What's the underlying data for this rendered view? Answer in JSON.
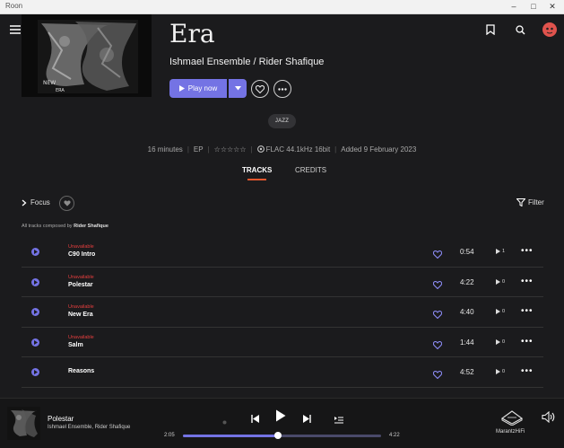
{
  "window": {
    "title": "Roon",
    "controls": [
      "minimize-icon",
      "maximize-icon",
      "close-icon"
    ]
  },
  "album": {
    "title": "Era",
    "artists": "Ishmael Ensemble / Rider Shafique",
    "cover_text": [
      "NEW",
      "ERA"
    ],
    "play_label": "Play now",
    "genre": "JAZZ",
    "meta": {
      "duration": "16 minutes",
      "type": "EP",
      "rating": "☆☆☆☆☆",
      "format": "FLAC 44.1kHz 16bit",
      "added": "Added 9 February 2023"
    }
  },
  "tabs": [
    {
      "label": "TRACKS",
      "active": true
    },
    {
      "label": "CREDITS",
      "active": false
    }
  ],
  "toolbar": {
    "focus_label": "Focus",
    "filter_label": "Filter"
  },
  "composed": {
    "prefix": "All tracks composed by",
    "composer": "Rider Shafique"
  },
  "tracks": [
    {
      "status": "Unavailable",
      "name": "C90 Intro",
      "duration": "0:54",
      "plays": "1"
    },
    {
      "status": "Unavailable",
      "name": "Polestar",
      "duration": "4:22",
      "plays": "0"
    },
    {
      "status": "Unavailable",
      "name": "New Era",
      "duration": "4:40",
      "plays": "0"
    },
    {
      "status": "Unavailable",
      "name": "Salm",
      "duration": "1:44",
      "plays": "0"
    },
    {
      "status": "",
      "name": "Reasons",
      "duration": "4:52",
      "plays": "0"
    }
  ],
  "player": {
    "title": "Polestar",
    "artist": "Ishmael Ensemble, Rider Shafique",
    "current_time": "2:05",
    "total_time": "4:22",
    "progress_fraction": 0.48,
    "zone": "MarantzHiFi"
  },
  "colors": {
    "accent": "#7473e4",
    "unavailable": "#e53e3e",
    "tab_underline": "#e4572e",
    "background": "#1b1b1d"
  }
}
